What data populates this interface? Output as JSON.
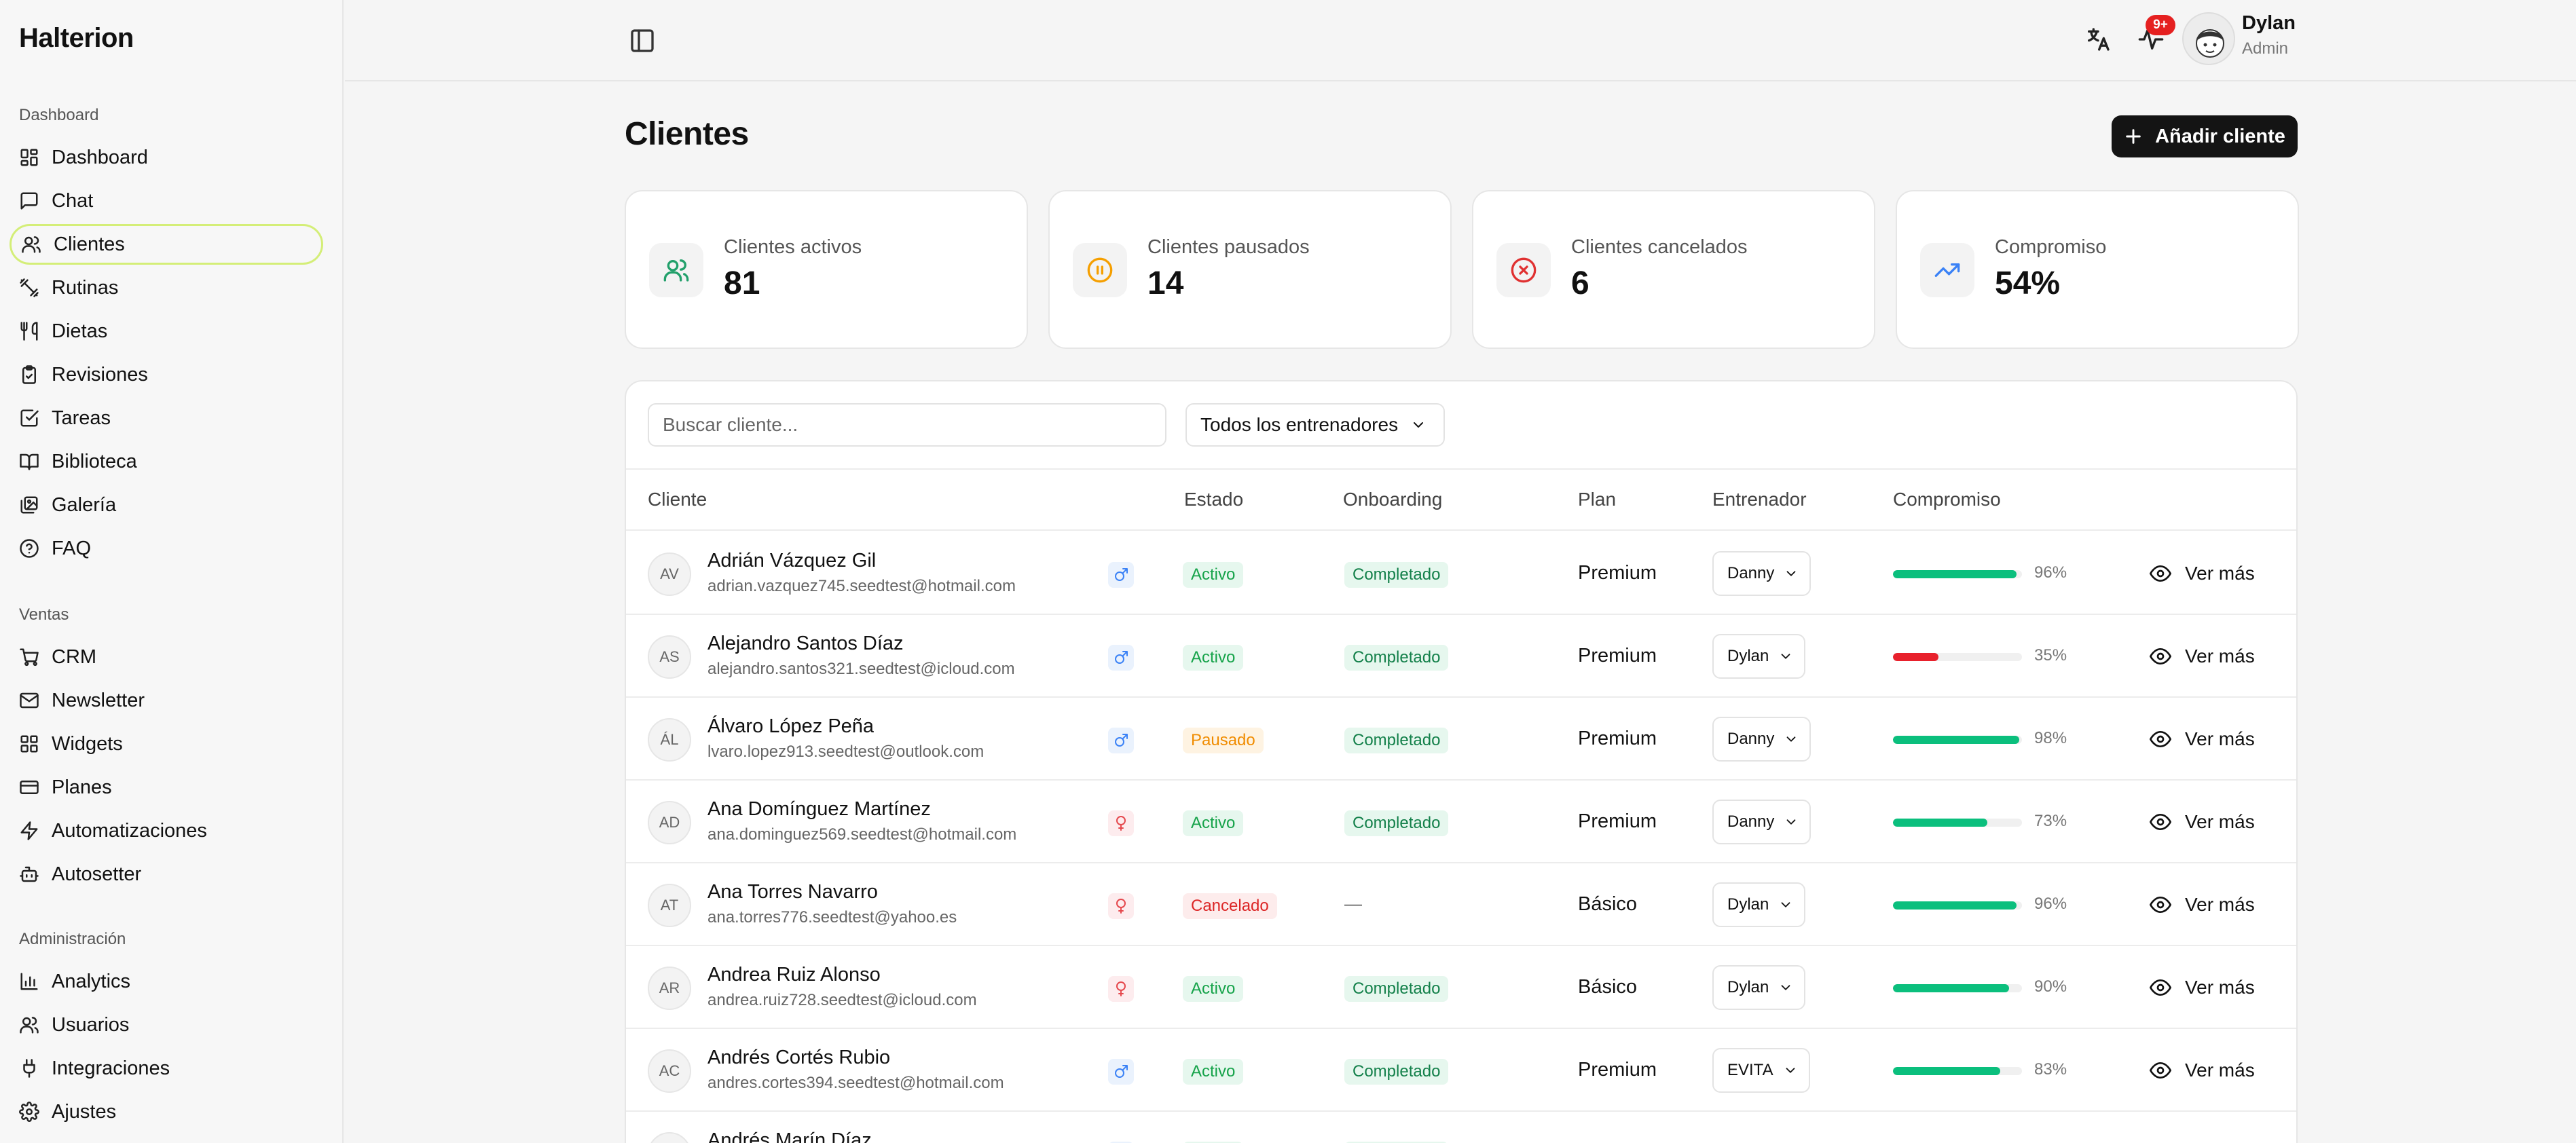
{
  "brand": "Halterion",
  "sidebar": {
    "sections": [
      {
        "label": "Dashboard",
        "items": [
          {
            "label": "Dashboard",
            "icon": "layout-grid-icon"
          },
          {
            "label": "Chat",
            "icon": "chat-icon"
          },
          {
            "label": "Clientes",
            "icon": "users-icon",
            "active": true
          },
          {
            "label": "Rutinas",
            "icon": "dumbbell-icon"
          },
          {
            "label": "Dietas",
            "icon": "utensils-icon"
          },
          {
            "label": "Revisiones",
            "icon": "clipboard-check-icon"
          },
          {
            "label": "Tareas",
            "icon": "check-square-icon"
          },
          {
            "label": "Biblioteca",
            "icon": "book-open-icon"
          },
          {
            "label": "Galería",
            "icon": "gallery-icon"
          },
          {
            "label": "FAQ",
            "icon": "help-circle-icon"
          }
        ]
      },
      {
        "label": "Ventas",
        "items": [
          {
            "label": "CRM",
            "icon": "cart-icon"
          },
          {
            "label": "Newsletter",
            "icon": "mail-icon"
          },
          {
            "label": "Widgets",
            "icon": "widgets-icon"
          },
          {
            "label": "Planes",
            "icon": "credit-card-icon"
          },
          {
            "label": "Automatizaciones",
            "icon": "zap-icon"
          },
          {
            "label": "Autosetter",
            "icon": "bot-icon"
          }
        ]
      },
      {
        "label": "Administración",
        "items": [
          {
            "label": "Analytics",
            "icon": "bar-chart-icon"
          },
          {
            "label": "Usuarios",
            "icon": "users-icon"
          },
          {
            "label": "Integraciones",
            "icon": "plug-icon"
          },
          {
            "label": "Ajustes",
            "icon": "gear-icon"
          }
        ]
      }
    ]
  },
  "header": {
    "notification_badge": "9+",
    "user": {
      "name": "Dylan",
      "role": "Admin"
    }
  },
  "page": {
    "title": "Clientes",
    "add_button": "Añadir cliente"
  },
  "stats": [
    {
      "label": "Clientes activos",
      "value": "81",
      "icon": "users-icon",
      "color": "#22a06b"
    },
    {
      "label": "Clientes pausados",
      "value": "14",
      "icon": "pause-circle-icon",
      "color": "#f59f00"
    },
    {
      "label": "Clientes cancelados",
      "value": "6",
      "icon": "x-circle-icon",
      "color": "#e03131"
    },
    {
      "label": "Compromiso",
      "value": "54%",
      "icon": "trending-up-icon",
      "color": "#3b82f6"
    }
  ],
  "table": {
    "search_placeholder": "Buscar cliente...",
    "trainer_filter": "Todos los entrenadores",
    "columns": [
      "Cliente",
      "Estado",
      "Onboarding",
      "Plan",
      "Entrenador",
      "Compromiso"
    ],
    "view_more_label": "Ver más",
    "rows": [
      {
        "initials": "AV",
        "name": "Adrián Vázquez Gil",
        "email": "adrian.vazquez745.seedtest@hotmail.com",
        "gender": "male",
        "status": "Activo",
        "onboarding": "Completado",
        "plan": "Premium",
        "trainer": "Danny",
        "commitment": 96,
        "commitment_label": "96%"
      },
      {
        "initials": "AS",
        "name": "Alejandro Santos Díaz",
        "email": "alejandro.santos321.seedtest@icloud.com",
        "gender": "male",
        "status": "Activo",
        "onboarding": "Completado",
        "plan": "Premium",
        "trainer": "Dylan",
        "commitment": 35,
        "commitment_label": "35%"
      },
      {
        "initials": "ÁL",
        "name": "Álvaro López Peña",
        "email": "lvaro.lopez913.seedtest@outlook.com",
        "gender": "male",
        "status": "Pausado",
        "onboarding": "Completado",
        "plan": "Premium",
        "trainer": "Danny",
        "commitment": 98,
        "commitment_label": "98%"
      },
      {
        "initials": "AD",
        "name": "Ana Domínguez Martínez",
        "email": "ana.dominguez569.seedtest@hotmail.com",
        "gender": "female",
        "status": "Activo",
        "onboarding": "Completado",
        "plan": "Premium",
        "trainer": "Danny",
        "commitment": 73,
        "commitment_label": "73%"
      },
      {
        "initials": "AT",
        "name": "Ana Torres Navarro",
        "email": "ana.torres776.seedtest@yahoo.es",
        "gender": "female",
        "status": "Cancelado",
        "onboarding": "—",
        "plan": "Básico",
        "trainer": "Dylan",
        "commitment": 96,
        "commitment_label": "96%"
      },
      {
        "initials": "AR",
        "name": "Andrea Ruiz Alonso",
        "email": "andrea.ruiz728.seedtest@icloud.com",
        "gender": "female",
        "status": "Activo",
        "onboarding": "Completado",
        "plan": "Básico",
        "trainer": "Dylan",
        "commitment": 90,
        "commitment_label": "90%"
      },
      {
        "initials": "AC",
        "name": "Andrés Cortés Rubio",
        "email": "andres.cortes394.seedtest@hotmail.com",
        "gender": "male",
        "status": "Activo",
        "onboarding": "Completado",
        "plan": "Premium",
        "trainer": "EVITA",
        "commitment": 83,
        "commitment_label": "83%"
      },
      {
        "initials": "AM",
        "name": "Andrés Marín Díaz",
        "email": "",
        "gender": "male",
        "status": "Activo",
        "onboarding": "Completado",
        "plan": "",
        "trainer": "",
        "commitment": 0,
        "commitment_label": ""
      }
    ]
  },
  "colors": {
    "good": "#0bbf7d",
    "bad": "#e8212c",
    "accent_outline": "#d4ee78"
  }
}
